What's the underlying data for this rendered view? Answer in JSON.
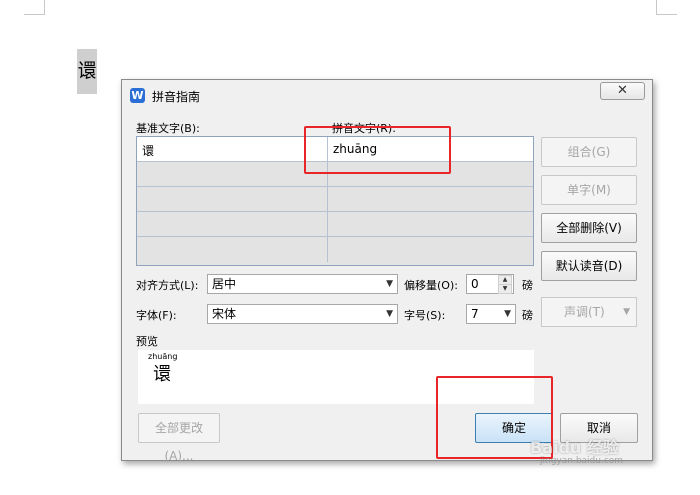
{
  "document": {
    "character": "𫍽"
  },
  "dialog": {
    "title": "拼音指南",
    "app_icon_letter": "W",
    "close_symbol": "✕",
    "base_text_label": "基准文字(B):",
    "ruby_text_label": "拼音文字(R):",
    "rows": [
      {
        "base": "𫍽",
        "ruby": "zhuāng"
      },
      {
        "base": "",
        "ruby": ""
      },
      {
        "base": "",
        "ruby": ""
      },
      {
        "base": "",
        "ruby": ""
      },
      {
        "base": "",
        "ruby": ""
      }
    ],
    "side_buttons": {
      "group": "组合(G)",
      "single": "单字(M)",
      "clear_all": "全部删除(V)",
      "default_reading": "默认读音(D)",
      "tone": "声调(T)"
    },
    "alignment_label": "对齐方式(L):",
    "alignment_value": "居中",
    "offset_label": "偏移量(O):",
    "offset_value": "0",
    "offset_unit": "磅",
    "font_label": "字体(F):",
    "font_value": "宋体",
    "size_label": "字号(S):",
    "size_value": "7",
    "size_unit": "磅",
    "preview_label": "预览",
    "preview_pinyin": "zhuāng",
    "preview_char": "𫍽",
    "apply_all_button": "全部更改 (A)...",
    "ok_button": "确定",
    "cancel_button": "取消"
  },
  "watermark": {
    "main": "Baidu 经验",
    "sub": "jingyan.baidu.com"
  },
  "colors": {
    "highlight": "#e8262a",
    "app_icon": "#2b6fd6"
  }
}
